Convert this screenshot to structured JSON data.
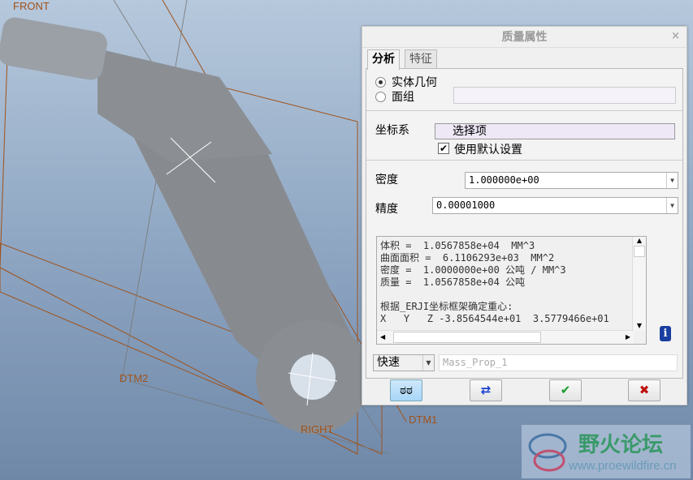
{
  "viewport": {
    "datums": {
      "front": "FRONT",
      "dtm2": "DTM2",
      "right": "RIGHT",
      "dtm1": "DTM1"
    }
  },
  "dialog": {
    "title": "质量属性",
    "close": "×",
    "tabs": [
      {
        "label": "分析",
        "active": true
      },
      {
        "label": "特征",
        "active": false
      }
    ],
    "geometry": {
      "solid": "实体几何",
      "quilt": "面组",
      "selected": "solid"
    },
    "csys": {
      "label": "坐标系",
      "value": "选择项",
      "default_label": "使用默认设置",
      "default_checked": true
    },
    "density": {
      "label": "密度",
      "value": "1.000000e+00"
    },
    "accuracy": {
      "label": "精度",
      "value": "0.00001000"
    },
    "output": [
      "体积 =  1.0567858e+04  MM^3",
      "曲面面积 =  6.1106293e+03  MM^2",
      "密度 =  1.0000000e+00 公吨 / MM^3",
      "质量 =  1.0567858e+04 公吨",
      "",
      "根据_ERJI坐标框架确定重心:",
      "X   Y   Z -3.8564544e+01  3.5779466e+01"
    ],
    "mode": "快速",
    "feature_name_placeholder": "Mass_Prop_1",
    "buttons": [
      "preview",
      "repeat",
      "ok",
      "cancel"
    ]
  },
  "watermark": {
    "name": "野火论坛",
    "url": "www.proewildfire.cn"
  }
}
